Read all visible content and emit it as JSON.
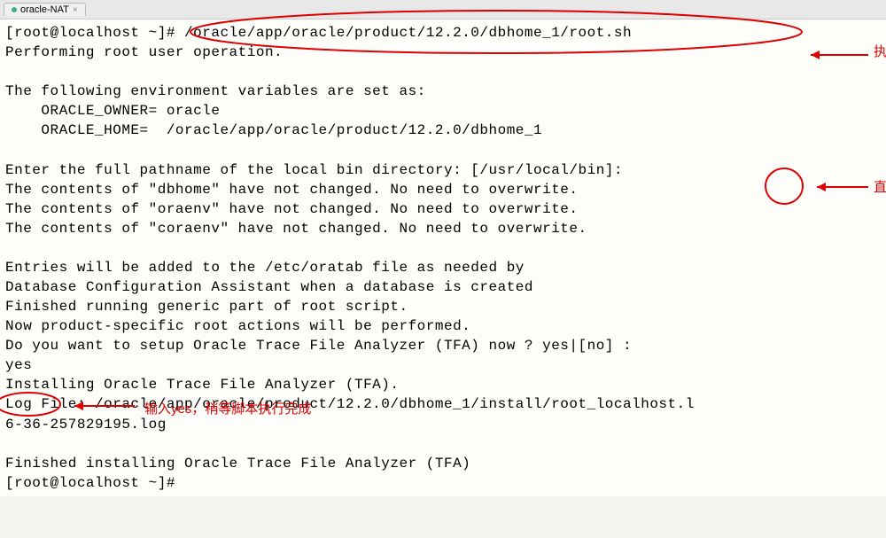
{
  "tab": {
    "label": "oracle-NAT",
    "close": "×"
  },
  "terminal": {
    "prompt1": "[root@localhost ~]# ",
    "cmd1": "/oracle/app/oracle/product/12.2.0/dbhome_1/root.sh",
    "line2": "Performing root user operation.",
    "blank1": "",
    "line3": "The following environment variables are set as:",
    "line4": "    ORACLE_OWNER= oracle",
    "line5": "    ORACLE_HOME=  /oracle/app/oracle/product/12.2.0/dbhome_1",
    "blank2": "",
    "line6": "Enter the full pathname of the local bin directory: [/usr/local/bin]:",
    "line7": "The contents of \"dbhome\" have not changed. No need to overwrite.",
    "line8": "The contents of \"oraenv\" have not changed. No need to overwrite.",
    "line9": "The contents of \"coraenv\" have not changed. No need to overwrite.",
    "blank3": "",
    "line10": "Entries will be added to the /etc/oratab file as needed by",
    "line11": "Database Configuration Assistant when a database is created",
    "line12": "Finished running generic part of root script.",
    "line13": "Now product-specific root actions will be performed.",
    "line14": "Do you want to setup Oracle Trace File Analyzer (TFA) now ? yes|[no] :",
    "line15": "yes",
    "line16": "Installing Oracle Trace File Analyzer (TFA).",
    "line17": "Log File: /oracle/app/oracle/product/12.2.0/dbhome_1/install/root_localhost.l",
    "line18": "6-36-257829195.log",
    "blank4": "",
    "line19": "Finished installing Oracle Trace File Analyzer (TFA)",
    "prompt2": "[root@localhost ~]#"
  },
  "annotations": {
    "right1": "执",
    "right2": "直",
    "yes_note": "输入yes，稍等脚本执行完成"
  }
}
